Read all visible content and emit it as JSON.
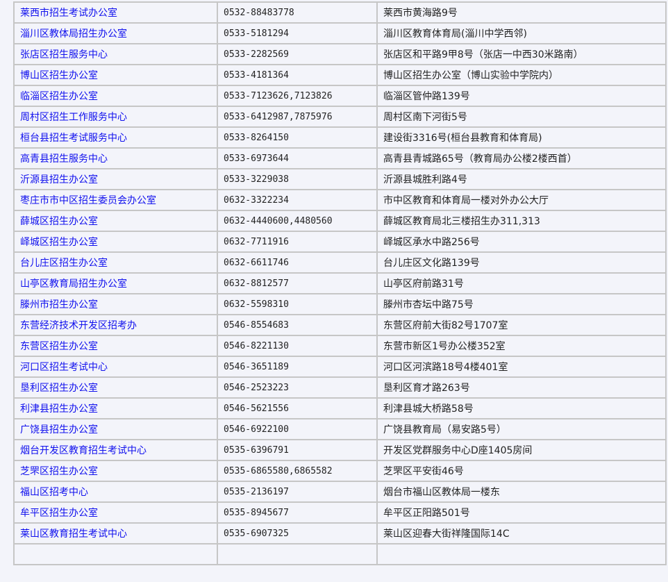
{
  "rows": [
    {
      "name": "莱西市招生考试办公室",
      "phone": "0532-88483778",
      "address": "莱西市黄海路9号"
    },
    {
      "name": "淄川区教体局招生办公室",
      "phone": "0533-5181294",
      "address": "淄川区教育体育局(淄川中学西邻)"
    },
    {
      "name": "张店区招生服务中心",
      "phone": "0533-2282569",
      "address": "张店区和平路9甲8号（张店一中西30米路南）"
    },
    {
      "name": "博山区招生办公室",
      "phone": "0533-4181364",
      "address": "博山区招生办公室（博山实验中学院内）"
    },
    {
      "name": "临淄区招生办公室",
      "phone": "0533-7123626,7123826",
      "address": "临淄区管仲路139号"
    },
    {
      "name": "周村区招生工作服务中心",
      "phone": "0533-6412987,7875976",
      "address": "周村区南下河街5号"
    },
    {
      "name": "桓台县招生考试服务中心",
      "phone": "0533-8264150",
      "address": "建设街3316号(桓台县教育和体育局)"
    },
    {
      "name": "高青县招生服务中心",
      "phone": "0533-6973644",
      "address": "高青县青城路65号（教育局办公楼2楼西首）"
    },
    {
      "name": "沂源县招生办公室",
      "phone": "0533-3229038",
      "address": "沂源县城胜利路4号"
    },
    {
      "name": "枣庄市市中区招生委员会办公室",
      "phone": "0632-3322234",
      "address": "市中区教育和体育局一楼对外办公大厅"
    },
    {
      "name": "薛城区招生办公室",
      "phone": "0632-4440600,4480560",
      "address": "薛城区教育局北三楼招生办311,313"
    },
    {
      "name": "峄城区招生办公室",
      "phone": "0632-7711916",
      "address": "峄城区承水中路256号"
    },
    {
      "name": "台儿庄区招生办公室",
      "phone": "0632-6611746",
      "address": "台儿庄区文化路139号"
    },
    {
      "name": "山亭区教育局招生办公室",
      "phone": "0632-8812577",
      "address": "山亭区府前路31号"
    },
    {
      "name": "滕州市招生办公室",
      "phone": "0632-5598310",
      "address": "滕州市杏坛中路75号"
    },
    {
      "name": "东营经济技术开发区招考办",
      "phone": "0546-8554683",
      "address": "东营区府前大街82号1707室"
    },
    {
      "name": "东营区招生办公室",
      "phone": "0546-8221130",
      "address": "东营市新区1号办公楼352室"
    },
    {
      "name": "河口区招生考试中心",
      "phone": "0546-3651189",
      "address": "河口区河滨路18号4楼401室"
    },
    {
      "name": "垦利区招生办公室",
      "phone": "0546-2523223",
      "address": "垦利区育才路263号"
    },
    {
      "name": "利津县招生办公室",
      "phone": "0546-5621556",
      "address": "利津县城大桥路58号"
    },
    {
      "name": "广饶县招生办公室",
      "phone": "0546-6922100",
      "address": "广饶县教育局（易安路5号）"
    },
    {
      "name": "烟台开发区教育招生考试中心",
      "phone": "0535-6396791",
      "address": "开发区党群服务中心D座1405房间"
    },
    {
      "name": "芝罘区招生办公室",
      "phone": "0535-6865580,6865582",
      "address": "芝罘区平安街46号"
    },
    {
      "name": "福山区招考中心",
      "phone": "0535-2136197",
      "address": "烟台市福山区教体局一楼东"
    },
    {
      "name": "牟平区招生办公室",
      "phone": "0535-8945677",
      "address": "牟平区正阳路501号"
    },
    {
      "name": "莱山区教育招生考试中心",
      "phone": "0535-6907325",
      "address": "莱山区迎春大街祥隆国际14C"
    }
  ]
}
